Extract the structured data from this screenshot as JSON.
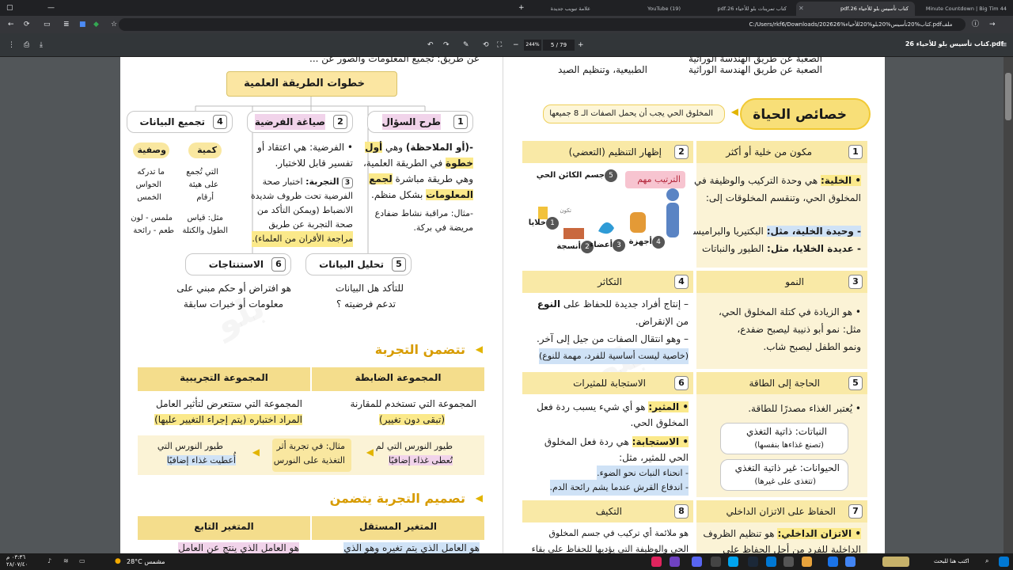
{
  "browser": {
    "tabs": [
      {
        "label": "44 Minute Countdown | Big Tim",
        "active": false
      },
      {
        "label": "كتاب تأسيس بلو للأحياء 26.pdf",
        "active": true
      },
      {
        "label": "كتاب تمرينات بلو للأحياء 26.pdf",
        "active": false
      },
      {
        "label": "(19) YouTube",
        "active": false
      },
      {
        "label": "علامة تبويب جديدة",
        "active": false
      }
    ],
    "url": "C:/Users/rkf6/Downloads/2026كتاب%20تأسيس%20بلو%20للأحياء%26.pdf",
    "url_prefix": "ملف"
  },
  "pdf": {
    "title": "كتاب تأسيس بلو للأحياء 26.pdf",
    "page_current": "5",
    "page_total": "79",
    "zoom": "244%"
  },
  "right": {
    "top_line1": "الصعبة عن طريق الهندسة الوراثية",
    "top_line2": "الطبيعية، وتنظيم الصيد",
    "section_title": "خصائص الحياة",
    "section_sub": "المخلوق الحي يجب أن يحمل الصفات الـ 8 جميعها",
    "items": [
      {
        "num": "1",
        "title": "مكون من خلية أو أكثر"
      },
      {
        "num": "2",
        "title": "إظهار التنظيم (التعضي)"
      },
      {
        "num": "3",
        "title": "النمو"
      },
      {
        "num": "4",
        "title": "التكاثر"
      },
      {
        "num": "5",
        "title": "الحاجة إلى الطاقة"
      },
      {
        "num": "6",
        "title": "الاستجابة للمثيرات"
      },
      {
        "num": "7",
        "title": "الحفاظ على الاتزان الداخلي"
      },
      {
        "num": "8",
        "title": "التكيف"
      }
    ],
    "cell1": {
      "l1a": "• الخلية:",
      "l1b": " هي وحدة التركيب والوظيفة في",
      "l2": "المخلوق الحي، وتنقسم المخلوقات إلى:",
      "l3a": "- وحيدة الخلية، مثل:",
      "l3b": " البكتيريا والبراميسوم",
      "l4a": "- عديدة الخلايا، مثل:",
      "l4b": " الطيور والنباتات"
    },
    "org": {
      "important": "الترتيب مهم",
      "s1": "خلايا",
      "s2": "أنسجة",
      "s3": "أعضاء",
      "s4": "أجهزة",
      "s5": "جسم الكائن الحي",
      "n1": "1",
      "n2": "2",
      "n3": "3",
      "n4": "4",
      "n5": "5",
      "arrow_label": "تكون"
    },
    "growth": {
      "l1": "• هو الزيادة في كتلة المخلوق الحي،",
      "l2": "مثل: نمو أبو ذنيبة ليصبح ضفدع،",
      "l3": "ونمو الطفل ليصبح شاب."
    },
    "repro": {
      "l1a": "– إنتاج أفراد جديدة للحفاظ على ",
      "l1b": "النوع",
      "l2": "من الإنقراض.",
      "l3": "– وهو انتقال الصفات من جيل إلى آخر.",
      "l4": "(خاصية ليست أساسية للفرد، مهمة للنوع)"
    },
    "energy": {
      "l1": "• يُعتبر الغذاء مصدرًا للطاقة.",
      "plants": "النباتات: ذاتية التغذي",
      "plants_sub": "(تصنع غذاءها بنفسها)",
      "animals": "الحيوانات: غير ذاتية التغذي",
      "animals_sub": "(تتغذى على غيرها)"
    },
    "resp": {
      "l1a": "• المثير:",
      "l1b": " هو أي شيء يسبب ردة فعل",
      "l2": "المخلوق الحي.",
      "l3a": "• الاستجابة:",
      "l3b": " هي ردة فعل المخلوق",
      "l4": "الحي للمثير، مثل:",
      "l5": "- انحناء النبات نحو الضوء.",
      "l6": "- اندفاع القرش عندما يشم رائحة الدم."
    },
    "homeo": {
      "l1a": "• الاتزان الداخلي:",
      "l1b": " هو تنظيم الظروف",
      "l2": "الداخلية للفرد من أجل الحفاظ على"
    },
    "adapt": {
      "l1": "هو ملائمة أي تركيب في جسم المخلوق",
      "l2": "الحي والوظيفة التي يؤديها للحفاظ على بقاء"
    }
  },
  "left": {
    "top_line": "عن طريق: تجميع المعلومات والصور عن ...",
    "method_title": "خطوات الطريقة العلمية",
    "steps": [
      {
        "num": "1",
        "label": "طرح السؤال"
      },
      {
        "num": "2",
        "label": "صياغة الفرضية"
      },
      {
        "num": "4",
        "label": "تجميع البيانات"
      },
      {
        "num": "5",
        "label": "تحليل البيانات"
      },
      {
        "num": "6",
        "label": "الاستنتاجات"
      }
    ],
    "q": {
      "l1a": "-(أو الملاحظة)",
      "l1b": " وهي ",
      "l1c": "أول",
      "l2a": "خطوة",
      "l2b": " في الطريقة العلمية،",
      "l3a": "وهي طريقة مباشرة ",
      "l3b": "لجمع",
      "l4a": "المعلومات",
      "l4b": " بشكل منظم.",
      "l5": "-مثال: مراقبة نشاط ضفادع",
      "l6": "مريضة في بركة."
    },
    "hyp": {
      "l1": "• الفرضية: هي اعتقاد أو",
      "l2": "تفسير قابل للاختبار.",
      "exp_num": "3",
      "exp_label": "التجربة:",
      "l3": " اختبار صحة",
      "l4": "الفرضية تحت ظروف شديدة",
      "l5": "الانضباط (ويمكن التأكد من",
      "l6": "صحة التجربة عن طريق",
      "l7": "مراجعة الأقران من العلماء)."
    },
    "data": {
      "quant": "كمية",
      "qual": "وصفية",
      "quant_l1": "التي تُجمع",
      "quant_l2": "على هيئة",
      "quant_l3": "أرقام",
      "quant_ex1": "مثل: قياس",
      "quant_ex2": "الطول والكتلة",
      "qual_l1": "ما تدركه",
      "qual_l2": "الحواس",
      "qual_l3": "الخمس",
      "qual_ex1": "ملمس - لون",
      "qual_ex2": "طعم - رائحة"
    },
    "analysis": {
      "l1": "للتأكد هل البيانات",
      "l2": "تدعم فرضيته ؟"
    },
    "concl": {
      "l1": "هو افتراض أو حكم مبني على",
      "l2": "معلومات أو خبرات سابقة"
    },
    "exp_title": "تتضمن التجربة",
    "control": {
      "head": "المجموعة الضابطة",
      "l1": "المجموعة التي تستخدم للمقارنة",
      "l2": "(تبقى دون تغيير)",
      "ex1": "طيور النورس التي لم",
      "ex2": "تُعطى غذاء إضافيًا"
    },
    "experimental": {
      "head": "المجموعة التجريبية",
      "l1": "المجموعة التي ستتعرض لتأثير العامل",
      "l2": "المراد اختباره (يتم إجراء التغيير عليها)",
      "ex1": "طيور النورس التي",
      "ex2": "أُعطيت غذاء إضافيًا"
    },
    "example": {
      "l1": "مثال: في تجربة أثر",
      "l2": "التغذية على النورس"
    },
    "design_title": "تصميم التجربة يتضمن",
    "indep": {
      "head": "المتغير المستقل",
      "l1": "هو العامل الذي يتم تغيره وهو الذي"
    },
    "dep": {
      "head": "المتغير التابع",
      "l1": "هو العامل الذي ينتج عن العامل"
    }
  },
  "taskbar": {
    "search": "اكتب هنا للبحث",
    "weather": "28°C مشمس",
    "time": "٠٣:٣٦ م",
    "date": "٢٨/٠٧/٤٠"
  }
}
